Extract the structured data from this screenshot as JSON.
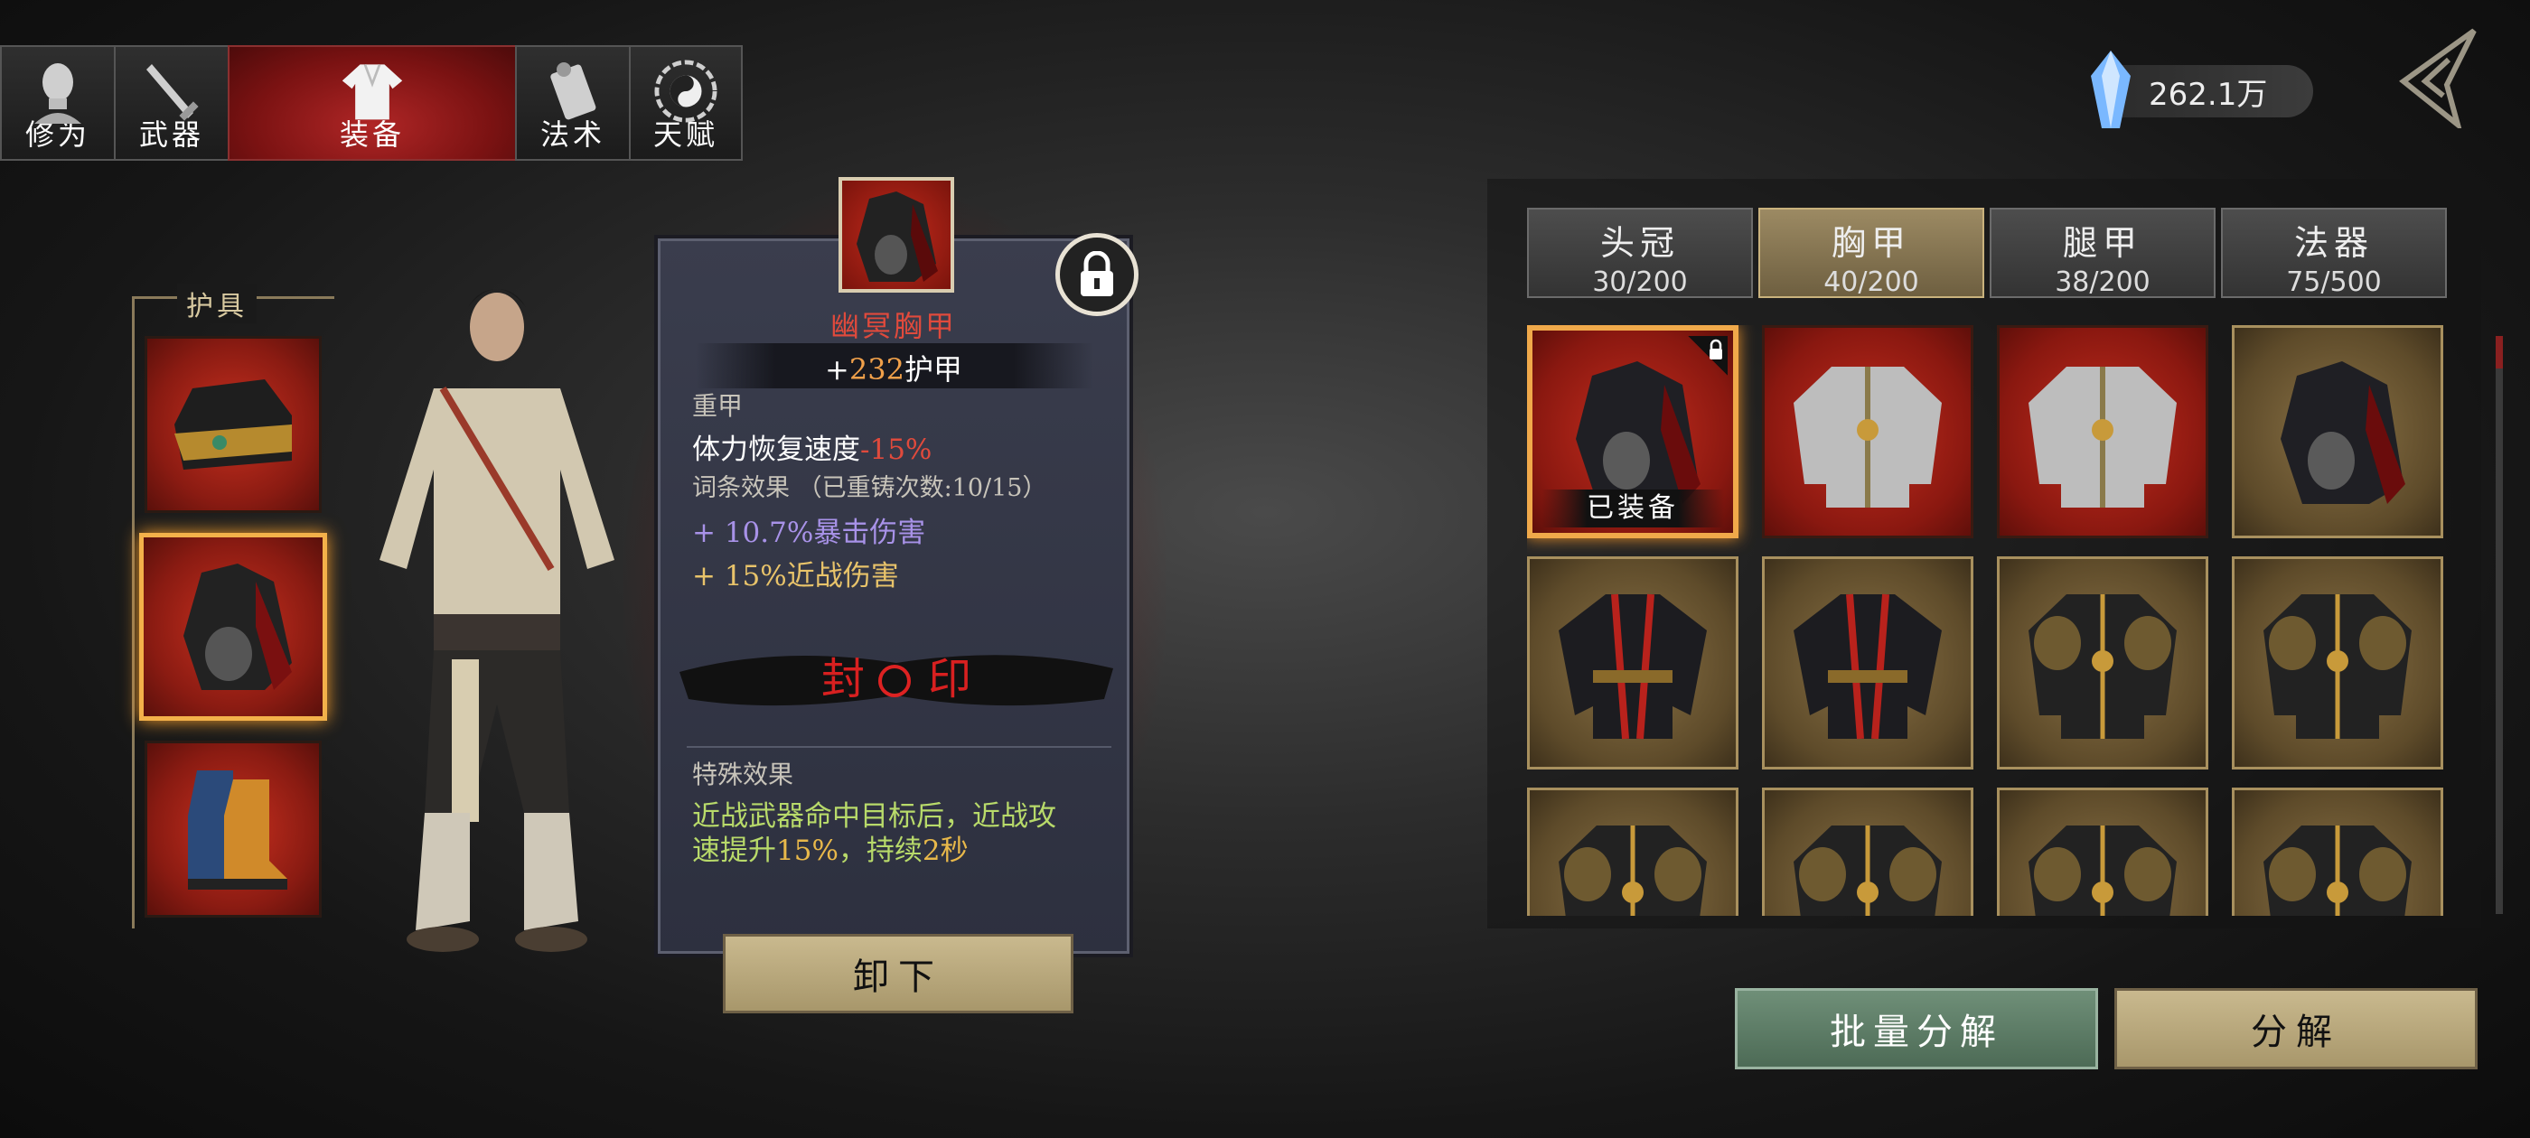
{
  "tabs": [
    {
      "label": "修为",
      "icon": "monk-head-icon",
      "active": false
    },
    {
      "label": "武器",
      "icon": "sword-icon",
      "active": false
    },
    {
      "label": "装备",
      "icon": "robe-icon",
      "active": true
    },
    {
      "label": "法术",
      "icon": "scroll-icon",
      "active": false
    },
    {
      "label": "天赋",
      "icon": "bagua-icon",
      "active": false
    }
  ],
  "currency": {
    "value": "262.1万",
    "icon": "crystal-icon"
  },
  "armor_section": {
    "title": "护具"
  },
  "item": {
    "name": "幽冥胸甲",
    "stat_prefix": "+",
    "stat_value": "232",
    "stat_label": "护甲",
    "type": "重甲",
    "penalty_label": "体力恢复速度",
    "penalty_value": "-15%",
    "affix_header": "词条效果 （已重铸次数:10/15）",
    "affix1_value": "+ 10.7%",
    "affix1_label": "暴击伤害",
    "affix2_value": "+ 15%",
    "affix2_label": "近战伤害",
    "seal_label": "封印",
    "special_title": "特殊效果",
    "special_line1": "近战武器命中目标后，近战攻",
    "special_line2_prefix": "速提升",
    "special_line2_value1": "15%",
    "special_line2_mid": "，持续",
    "special_line2_value2": "2秒",
    "unequip_label": "卸下"
  },
  "categories": [
    {
      "name": "头冠",
      "count": "30/200",
      "active": false
    },
    {
      "name": "胸甲",
      "count": "40/200",
      "active": true
    },
    {
      "name": "腿甲",
      "count": "38/200",
      "active": false
    },
    {
      "name": "法器",
      "count": "75/500",
      "active": false
    }
  ],
  "inventory_equipped_tag": "已装备",
  "inventory": [
    {
      "bg": "red",
      "kind": "dark-cape",
      "equipped": true,
      "locked": true
    },
    {
      "bg": "red",
      "kind": "silver-plate"
    },
    {
      "bg": "red",
      "kind": "silver-plate"
    },
    {
      "bg": "gold",
      "kind": "dark-cape"
    },
    {
      "bg": "gold",
      "kind": "black-robe"
    },
    {
      "bg": "gold",
      "kind": "black-robe"
    },
    {
      "bg": "gold",
      "kind": "black-gold-plate"
    },
    {
      "bg": "gold",
      "kind": "black-gold-plate"
    },
    {
      "bg": "gold",
      "kind": "black-gold-plate"
    },
    {
      "bg": "gold",
      "kind": "black-gold-plate"
    },
    {
      "bg": "gold",
      "kind": "black-gold-plate"
    },
    {
      "bg": "gold",
      "kind": "black-gold-plate"
    }
  ],
  "buttons": {
    "bulk": "批量分解",
    "disassemble": "分解"
  }
}
